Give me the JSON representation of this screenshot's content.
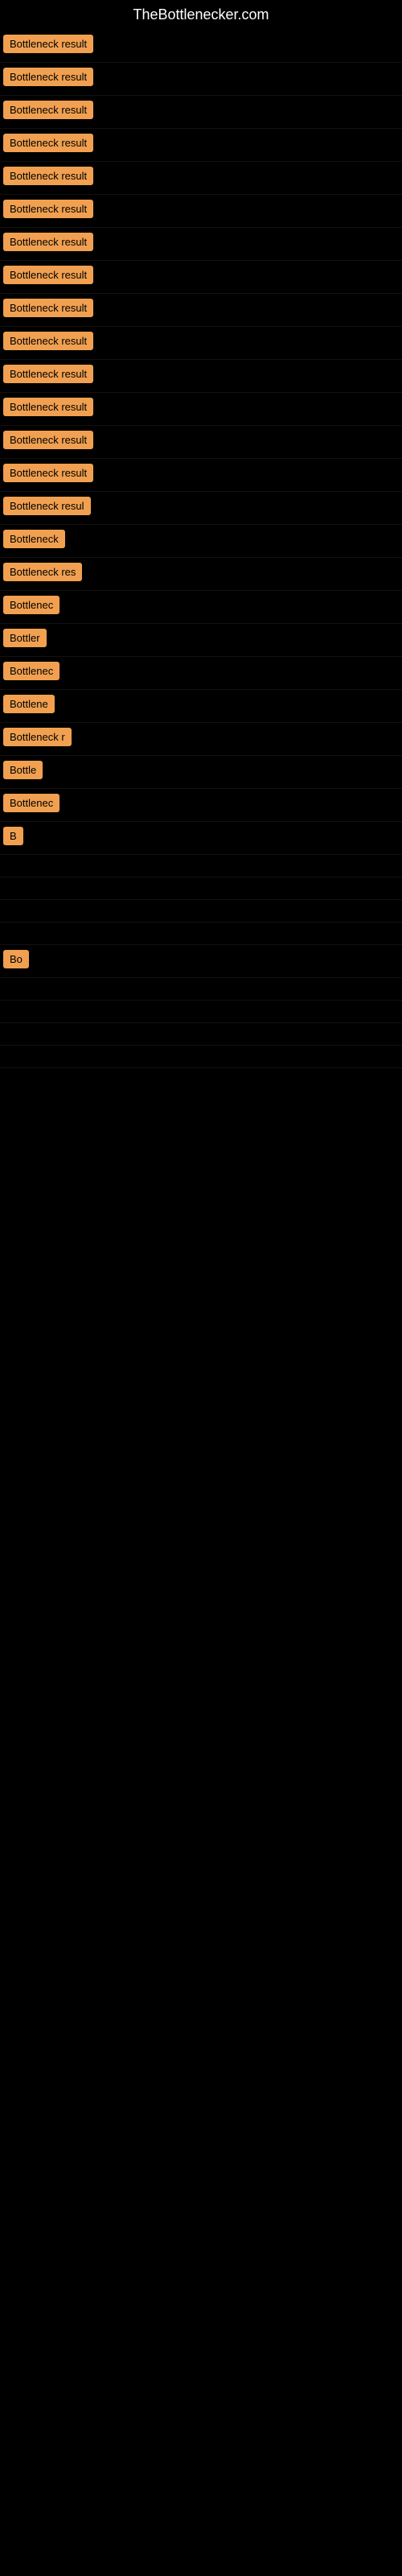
{
  "site": {
    "title": "TheBottlenecker.com"
  },
  "rows": [
    {
      "label": "Bottleneck result",
      "width": "100%"
    },
    {
      "label": "Bottleneck result",
      "width": "100%"
    },
    {
      "label": "Bottleneck result",
      "width": "100%"
    },
    {
      "label": "Bottleneck result",
      "width": "100%"
    },
    {
      "label": "Bottleneck result",
      "width": "100%"
    },
    {
      "label": "Bottleneck result",
      "width": "100%"
    },
    {
      "label": "Bottleneck result",
      "width": "100%"
    },
    {
      "label": "Bottleneck result",
      "width": "100%"
    },
    {
      "label": "Bottleneck result",
      "width": "100%"
    },
    {
      "label": "Bottleneck result",
      "width": "100%"
    },
    {
      "label": "Bottleneck result",
      "width": "100%"
    },
    {
      "label": "Bottleneck result",
      "width": "100%"
    },
    {
      "label": "Bottleneck result",
      "width": "100%"
    },
    {
      "label": "Bottleneck result",
      "width": "100%"
    },
    {
      "label": "Bottleneck resul",
      "width": "95%"
    },
    {
      "label": "Bottleneck",
      "width": "60%"
    },
    {
      "label": "Bottleneck res",
      "width": "80%"
    },
    {
      "label": "Bottlenec",
      "width": "55%"
    },
    {
      "label": "Bottler",
      "width": "42%"
    },
    {
      "label": "Bottlenec",
      "width": "55%"
    },
    {
      "label": "Bottlene",
      "width": "50%"
    },
    {
      "label": "Bottleneck r",
      "width": "65%"
    },
    {
      "label": "Bottle",
      "width": "38%"
    },
    {
      "label": "Bottlenec",
      "width": "55%"
    },
    {
      "label": "B",
      "width": "18%"
    },
    {
      "label": "",
      "width": "5%"
    },
    {
      "label": "",
      "width": "0%"
    },
    {
      "label": "",
      "width": "0%"
    },
    {
      "label": "",
      "width": "0%"
    },
    {
      "label": "Bo",
      "width": "22%"
    },
    {
      "label": "",
      "width": "0%"
    },
    {
      "label": "",
      "width": "0%"
    },
    {
      "label": "",
      "width": "0%"
    },
    {
      "label": "",
      "width": "0%"
    }
  ]
}
